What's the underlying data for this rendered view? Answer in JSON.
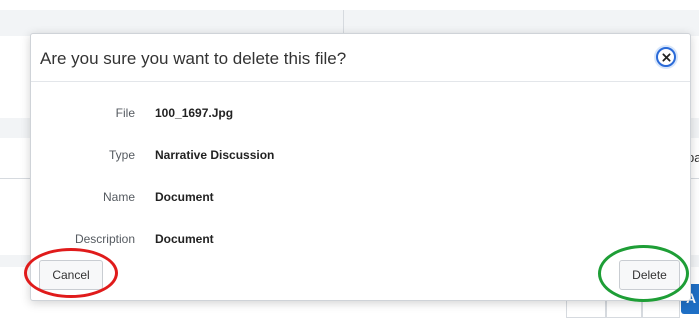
{
  "dialog": {
    "title": "Are you sure you want to delete this file?",
    "close_icon": "close-icon",
    "fields": [
      {
        "label": "File",
        "value": "100_1697.Jpg"
      },
      {
        "label": "Type",
        "value": "Narrative Discussion"
      },
      {
        "label": "Name",
        "value": "Document"
      },
      {
        "label": "Description",
        "value": "Document"
      }
    ],
    "cancel_label": "Cancel",
    "delete_label": "Delete"
  },
  "background": {
    "partial_text": "pa",
    "partial_button_label": "A"
  },
  "colors": {
    "close_ring": "#2a6ad8",
    "highlight_cancel": "#e01b1b",
    "highlight_delete": "#1e9e36",
    "background_button": "#1f6fc5"
  }
}
